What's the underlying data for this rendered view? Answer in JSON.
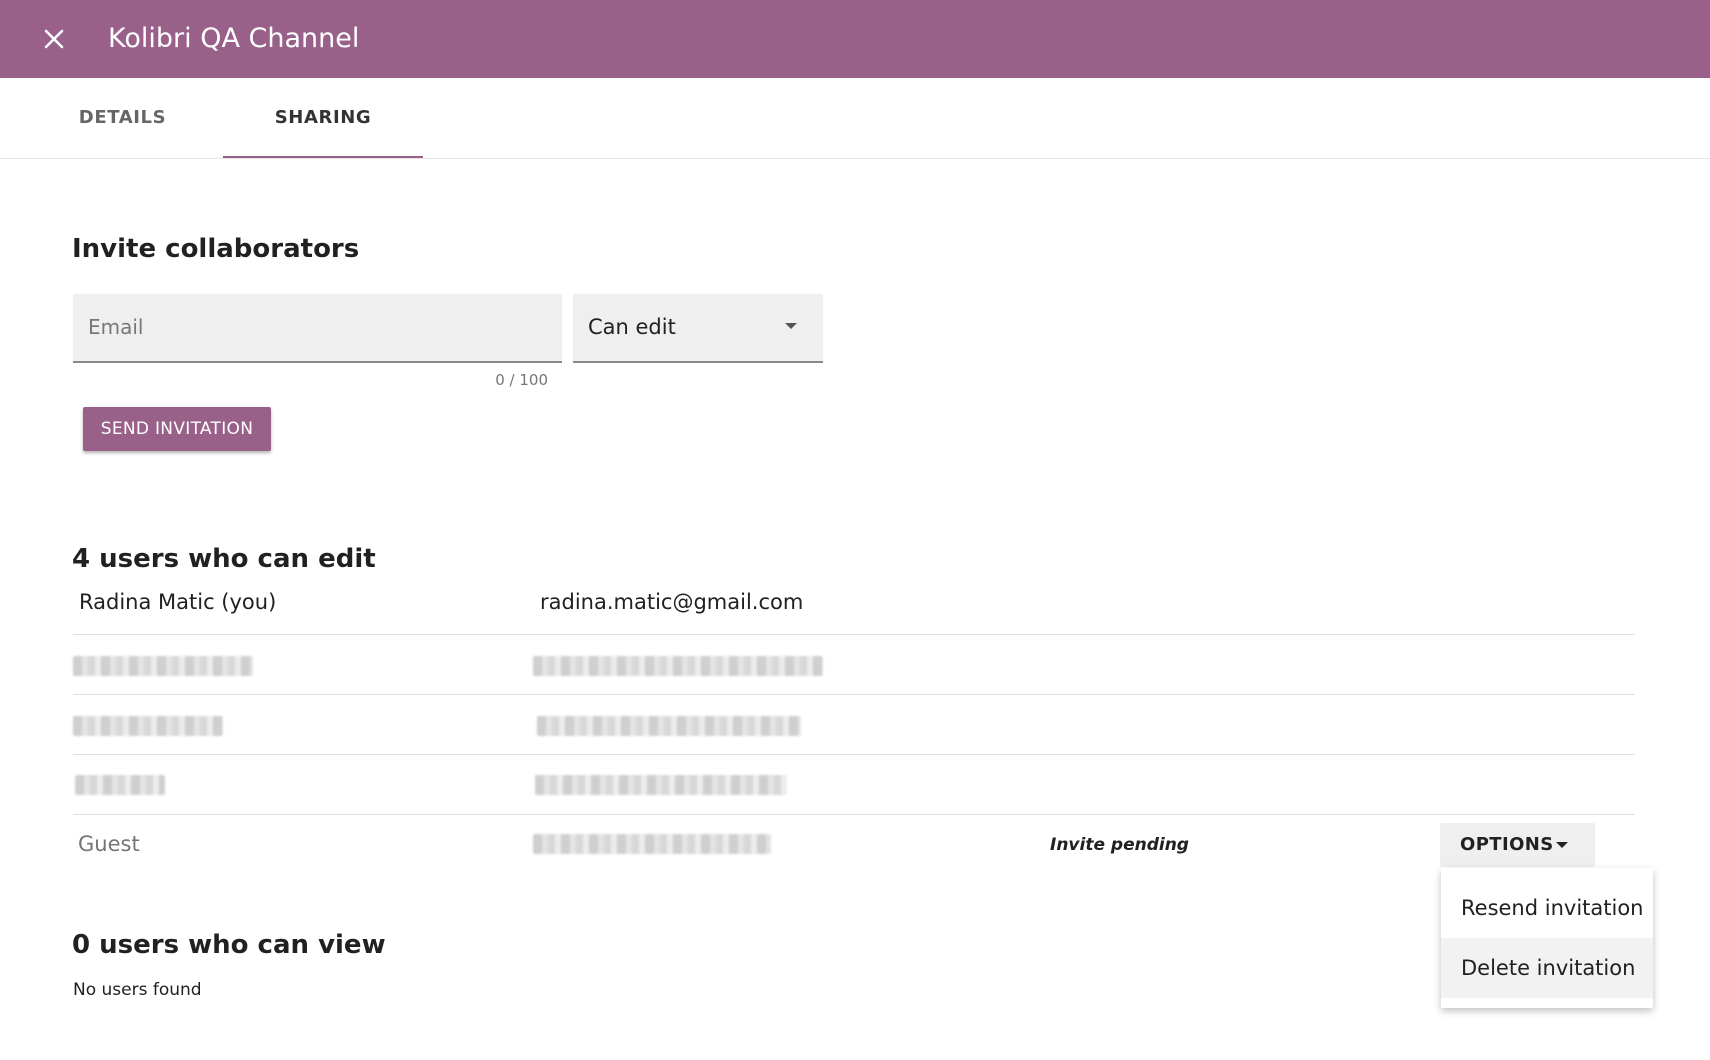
{
  "appbar": {
    "title": "Kolibri QA Channel",
    "close_icon": "close-icon",
    "color": "#996189"
  },
  "tabs": [
    {
      "label": "DETAILS",
      "active": false
    },
    {
      "label": "SHARING",
      "active": true
    }
  ],
  "invite": {
    "heading": "Invite collaborators",
    "email_placeholder": "Email",
    "email_value": "",
    "counter": "0 / 100",
    "permission_selected": "Can edit",
    "send_label": "SEND INVITATION"
  },
  "editors": {
    "heading": "4 users who can edit",
    "rows": [
      {
        "name": "Radina Matic (you)",
        "email": "radina.matic@gmail.com"
      },
      {
        "name": "",
        "email": "",
        "redacted": true
      },
      {
        "name": "",
        "email": "",
        "redacted": true
      },
      {
        "name": "",
        "email": "",
        "redacted": true
      }
    ],
    "pending": {
      "name": "Guest",
      "email": "",
      "redacted_email": true,
      "status": "Invite pending",
      "options_label": "OPTIONS",
      "menu": [
        "Resend invitation",
        "Delete invitation"
      ]
    }
  },
  "viewers": {
    "heading": "0 users who can view",
    "empty_text": "No users found"
  }
}
